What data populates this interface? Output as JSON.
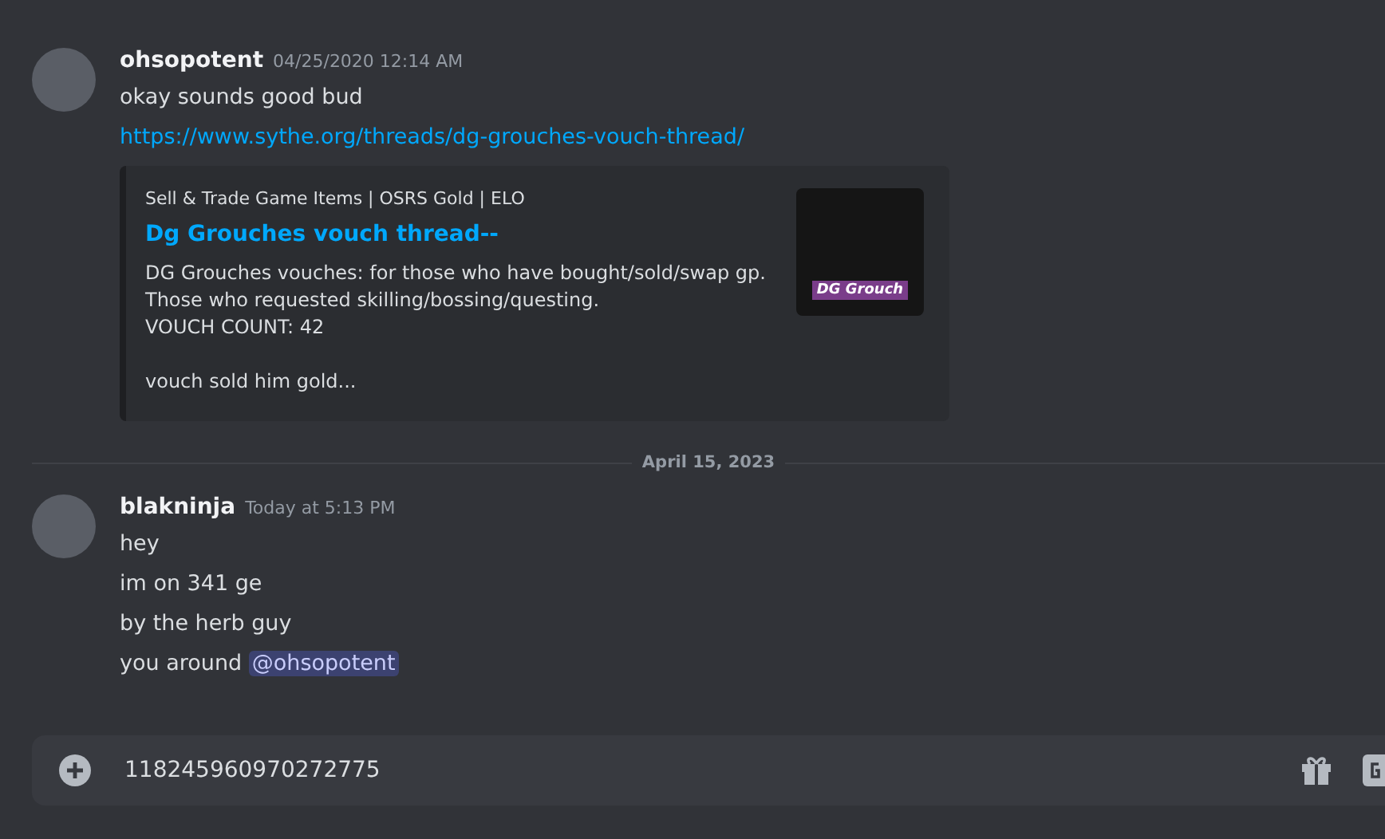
{
  "messages": [
    {
      "author": "ohsopotent",
      "timestamp": "04/25/2020 12:14 AM",
      "lines": [
        {
          "text": "okay sounds good bud"
        },
        {
          "kind": "link",
          "text": "https://www.sythe.org/threads/dg-grouches-vouch-thread/"
        }
      ],
      "embed": {
        "provider": "Sell & Trade Game Items | OSRS Gold | ELO",
        "title": "Dg Grouches vouch thread--",
        "description": [
          [
            "DG Grouches vouches: for those who have bought/sold/swap gp.",
            "Those who requested skilling/bossing/questing.",
            "VOUCH COUNT: 42"
          ],
          [
            "vouch sold him gold..."
          ]
        ],
        "thumbnail_text": "DG Grouch"
      }
    },
    {
      "divider": "April 15, 2023"
    },
    {
      "author": "blakninja",
      "timestamp": "Today at 5:13 PM",
      "lines": [
        {
          "text": "hey"
        },
        {
          "text": "im on 341 ge"
        },
        {
          "text": "by the herb guy"
        },
        {
          "text": "you around",
          "mention": "@ohsopotent"
        }
      ]
    }
  ],
  "input": {
    "value": "118245960970272775"
  }
}
